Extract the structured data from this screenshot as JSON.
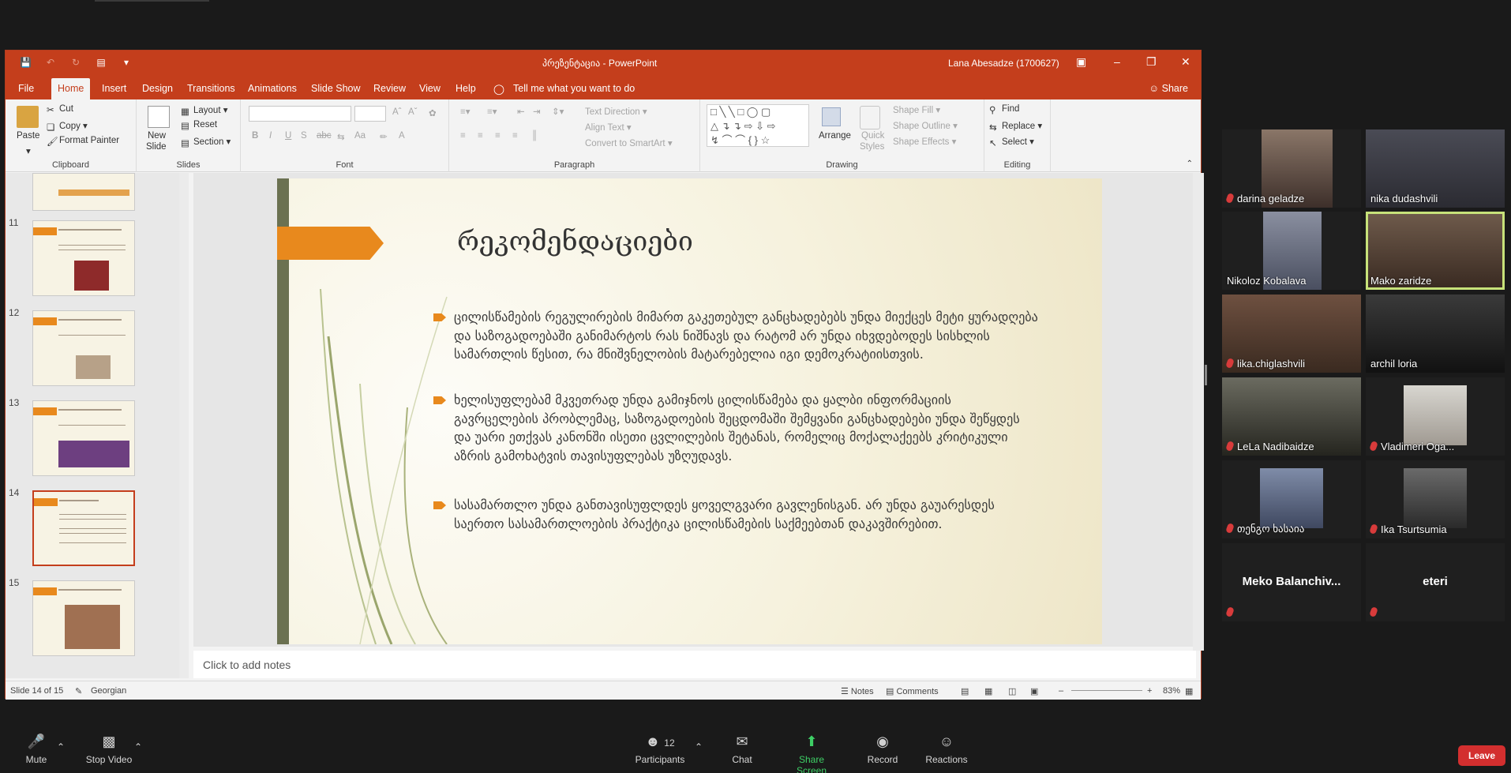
{
  "ppt": {
    "doc_title": "პრეზენტაცია  -  PowerPoint",
    "user": "Lana Abesadze (1700627)",
    "menu": [
      "File",
      "Home",
      "Insert",
      "Design",
      "Transitions",
      "Animations",
      "Slide Show",
      "Review",
      "View",
      "Help"
    ],
    "tell_me": "Tell me what you want to do",
    "share": "Share",
    "ribbon": {
      "clipboard": {
        "paste": "Paste",
        "cut": "Cut",
        "copy": "Copy",
        "format_painter": "Format Painter",
        "label": "Clipboard"
      },
      "slides": {
        "new_slide": "New",
        "new_slide2": "Slide",
        "layout": "Layout",
        "reset": "Reset",
        "section": "Section",
        "label": "Slides"
      },
      "font": {
        "label": "Font",
        "bold": "B",
        "italic": "I",
        "underline": "U",
        "strike": "S",
        "abc": "abc",
        "aa": "Aa",
        "a": "A"
      },
      "paragraph": {
        "text_direction": "Text Direction",
        "align_text": "Align Text",
        "convert_smartart": "Convert to SmartArt",
        "label": "Paragraph"
      },
      "drawing": {
        "arrange": "Arrange",
        "quick_styles": "Quick",
        "quick_styles2": "Styles",
        "shape_fill": "Shape Fill",
        "shape_outline": "Shape Outline",
        "shape_effects": "Shape Effects",
        "label": "Drawing"
      },
      "editing": {
        "find": "Find",
        "replace": "Replace",
        "select": "Select",
        "label": "Editing"
      }
    },
    "thumbnails": [
      {
        "num": "11"
      },
      {
        "num": "12"
      },
      {
        "num": "13"
      },
      {
        "num": "14"
      },
      {
        "num": "15"
      }
    ],
    "slide": {
      "title": "რეკომენდაციები",
      "bullets": [
        "ცილისწამების რეგულირების მიმართ გაკეთებულ განცხადებებს უნდა მიექცეს მეტი ყურადღება და საზოგადოებაში განიმარტოს რას ნიშნავს და რატომ არ უნდა იხვდებოდეს სისხლის სამართლის წესით, რა მნიშვნელობის მატარებელია იგი დემოკრატიისთვის.",
        "ხელისუფლებამ მკვეთრად უნდა გამიჯნოს ცილისწამება და ყალბი ინფორმაციის გავრცელების პრობლემაც, საზოგადოების შეცდომაში შემყვანი განცხადებები უნდა შეწყდეს და უარი ეთქვას კანონში ისეთი ცვლილების შეტანას, რომელიც მოქალაქეებს კრიტიკული აზრის გამოხატვის თავისუფლებას უზღუდავს.",
        "სასამართლო უნდა განთავისუფლდეს ყოველგვარი გავლენისგან. არ უნდა გაუარესდეს საერთო სასამართლოების პრაქტიკა ცილისწამების საქმეებთან დაკავშირებით."
      ]
    },
    "notes_placeholder": "Click to add notes",
    "status": {
      "slide_of": "Slide 14 of 15",
      "language": "Georgian",
      "notes": "Notes",
      "comments": "Comments",
      "zoom": "83%"
    }
  },
  "zoom": {
    "participants": [
      {
        "name": "darina geladze",
        "muted": true
      },
      {
        "name": "nika dudashvili",
        "muted": false
      },
      {
        "name": "Nikoloz Kobalava",
        "muted": false
      },
      {
        "name": "Mako zaridze",
        "muted": false
      },
      {
        "name": "lika.chiglashvili",
        "muted": true
      },
      {
        "name": "archil loria",
        "muted": false
      },
      {
        "name": "LeLa Nadibaidze",
        "muted": true
      },
      {
        "name": "Vladimeri Oga...",
        "muted": true
      },
      {
        "name": "თენგო ხასაია",
        "muted": true
      },
      {
        "name": "Ika Tsurtsumia",
        "muted": true
      },
      {
        "name": "Meko  Balanchiv...",
        "muted": true
      },
      {
        "name": "eteri",
        "muted": true
      }
    ],
    "toolbar": {
      "mute": "Mute",
      "stop_video": "Stop Video",
      "participants": "Participants",
      "participants_count": "12",
      "chat": "Chat",
      "share_screen": "Share Screen",
      "record": "Record",
      "reactions": "Reactions",
      "leave": "Leave"
    }
  }
}
